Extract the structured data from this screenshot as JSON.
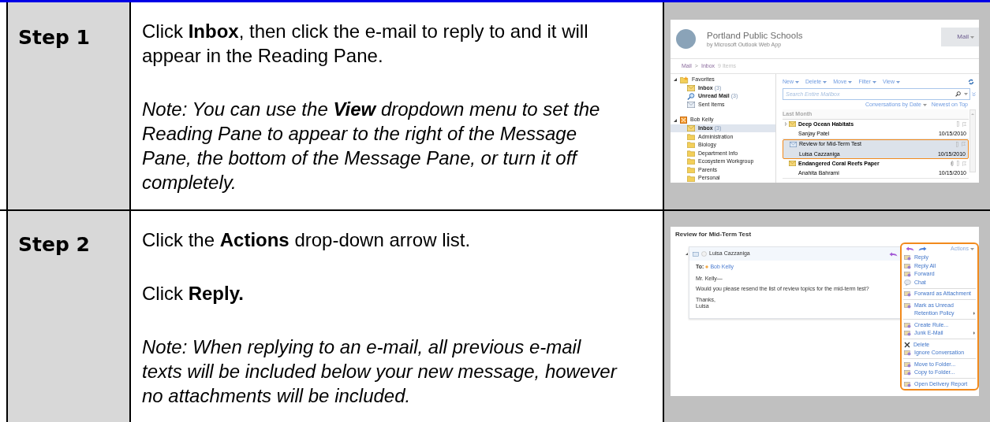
{
  "steps": [
    {
      "label": "Step 1",
      "paragraphs": [
        {
          "kind": "instruction",
          "text": "Click **Inbox**, then click the e-mail to reply to and it will appear in the Reading Pane."
        },
        {
          "kind": "note",
          "text": "Note: You can use the **View** dropdown menu to set the Reading Pane to appear to the right of the Message Pane, the bottom of the Message Pane, or turn it off completely."
        }
      ],
      "screenshot": {
        "kind": "mail_list",
        "title": "Portland Public Schools",
        "byline": "by Microsoft Outlook Web App",
        "top_button": "Mail",
        "breadcrumb": [
          "Mail",
          "Inbox"
        ],
        "breadcrumb_separator": ">",
        "item_count": "9 Items",
        "tree": [
          {
            "kind": "favorites",
            "label": "Favorites",
            "expanded": true,
            "selected": false,
            "children": [
              {
                "kind": "inbox",
                "label": "Inbox",
                "count": "(3)",
                "unread": true,
                "selected": false
              },
              {
                "kind": "search",
                "label": "Unread Mail",
                "count": "(3)",
                "unread": true,
                "selected": false
              },
              {
                "kind": "sent",
                "label": "Sent Items",
                "unread": false,
                "selected": false
              }
            ]
          },
          {
            "kind": "mailbox",
            "label": "Bob Kelly",
            "expanded": true,
            "selected": false,
            "children": [
              {
                "kind": "inbox",
                "label": "Inbox",
                "count": "(3)",
                "unread": true,
                "selected": true
              },
              {
                "kind": "folder",
                "label": "Administration",
                "unread": false,
                "selected": false
              },
              {
                "kind": "folder",
                "label": "Biology",
                "unread": false,
                "selected": false
              },
              {
                "kind": "folder",
                "label": "Department Info",
                "unread": false,
                "selected": false
              },
              {
                "kind": "folder",
                "label": "Ecosystem Workgroup",
                "unread": false,
                "selected": false
              },
              {
                "kind": "folder",
                "label": "Parents",
                "unread": false,
                "selected": false
              },
              {
                "kind": "folder",
                "label": "Personal",
                "unread": false,
                "selected": false
              }
            ]
          }
        ],
        "toolbar": [
          "New",
          "Delete",
          "Move",
          "Filter",
          "View"
        ],
        "search": {
          "placeholder": "Search Entire Mailbox"
        },
        "sort": "Conversations by Date",
        "order": "Newest on Top",
        "group": "Last Month",
        "messages": [
          {
            "subject": "Deep Ocean Habitats",
            "sender": "Sanjay Patel",
            "date": "10/15/2010",
            "unread": true,
            "selected": false,
            "thread": true,
            "attachment": false
          },
          {
            "subject": "Review for Mid-Term Test",
            "sender": "Luisa Cazzaniga",
            "date": "10/15/2010",
            "unread": false,
            "selected": true,
            "thread": false,
            "attachment": false
          },
          {
            "subject": "Endangered Coral Reefs Paper",
            "sender": "Anahita Bahrami",
            "date": "10/15/2010",
            "unread": true,
            "selected": false,
            "thread": false,
            "attachment": true
          }
        ]
      }
    },
    {
      "label": "Step 2",
      "paragraphs": [
        {
          "kind": "instruction",
          "text": "Click the **Actions** drop-down arrow list."
        },
        {
          "kind": "instruction",
          "text": "Click **Reply.**"
        },
        {
          "kind": "note",
          "text": "Note: When replying to an e-mail, all previous e-mail texts will be included below your new message, however no attachments will be included."
        }
      ],
      "screenshot": {
        "kind": "message_view",
        "title": "Review for Mid-Term Test",
        "sender": "Luisa Cazzaniga",
        "to_label": "To:",
        "to": "Bob Kelly",
        "body": [
          "Mr. Kelly—",
          "Would you please resend the list of review topics for the mid-term test?",
          "Thanks,\nLuisa"
        ],
        "actions_label": "Actions",
        "menu": [
          {
            "kind": "mail",
            "label": "Reply",
            "submenu": false,
            "divider_after": false
          },
          {
            "kind": "mail",
            "label": "Reply All",
            "submenu": false,
            "divider_after": false
          },
          {
            "kind": "mail",
            "label": "Forward",
            "submenu": false,
            "divider_after": false
          },
          {
            "kind": "chat",
            "label": "Chat",
            "submenu": false,
            "divider_after": true
          },
          {
            "kind": "mail",
            "label": "Forward as Attachment",
            "submenu": false,
            "divider_after": true
          },
          {
            "kind": "mail",
            "label": "Mark as Unread",
            "submenu": false,
            "divider_after": false
          },
          {
            "kind": "plain",
            "label": "Retention Policy",
            "submenu": true,
            "divider_after": true
          },
          {
            "kind": "mail",
            "label": "Create Rule...",
            "submenu": false,
            "divider_after": false
          },
          {
            "kind": "mail",
            "label": "Junk E-Mail",
            "submenu": true,
            "divider_after": true
          },
          {
            "kind": "delete",
            "label": "Delete",
            "submenu": false,
            "divider_after": false
          },
          {
            "kind": "mail",
            "label": "Ignore Conversation",
            "submenu": false,
            "divider_after": true
          },
          {
            "kind": "mail",
            "label": "Move to Folder...",
            "submenu": false,
            "divider_after": false
          },
          {
            "kind": "mail",
            "label": "Copy to Folder...",
            "submenu": false,
            "divider_after": true
          },
          {
            "kind": "mail",
            "label": "Open Delivery Report",
            "submenu": false,
            "divider_after": false
          }
        ]
      }
    }
  ]
}
